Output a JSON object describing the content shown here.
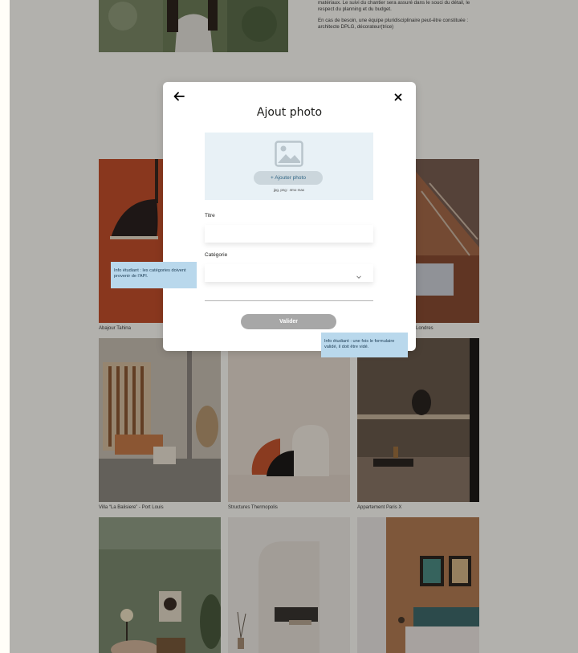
{
  "intro": {
    "line1": "matériaux. Le suivi du chantier sera assuré dans le souci du détail, le respect du planning et du budget.",
    "line2": "En cas de besoin, une équipe pluridisciplinaire peut-être constituée : architecte DPLG, décorateur(trice)"
  },
  "gallery": {
    "captions": [
      "Abajour Tahina",
      "Londres",
      "Villa “La Balisiere” - Port Louis",
      "Structures Thermopolis",
      "Appartement Paris X"
    ]
  },
  "modal": {
    "title": "Ajout photo",
    "add_photo_label": "+ Ajouter photo",
    "upload_hint": "jpg, png : 4mo max",
    "title_label": "Titre",
    "title_value": "",
    "category_label": "Catégorie",
    "category_value": "",
    "submit_label": "Valider",
    "back_icon": "arrow-left-icon",
    "close_icon": "close-icon"
  },
  "notes": {
    "categories": "Info étudiant : les catégories doivent provenir de l'API.",
    "form_reset": "Info étudiant : une fois le formulaire validé, il doit être vidé."
  },
  "colors": {
    "upload_zone": "#e8f1f6",
    "upload_button": "#cbd6dc",
    "upload_button_text": "#306685",
    "submit_disabled": "#a7a7a7",
    "note_bg": "#b9d8ec"
  }
}
